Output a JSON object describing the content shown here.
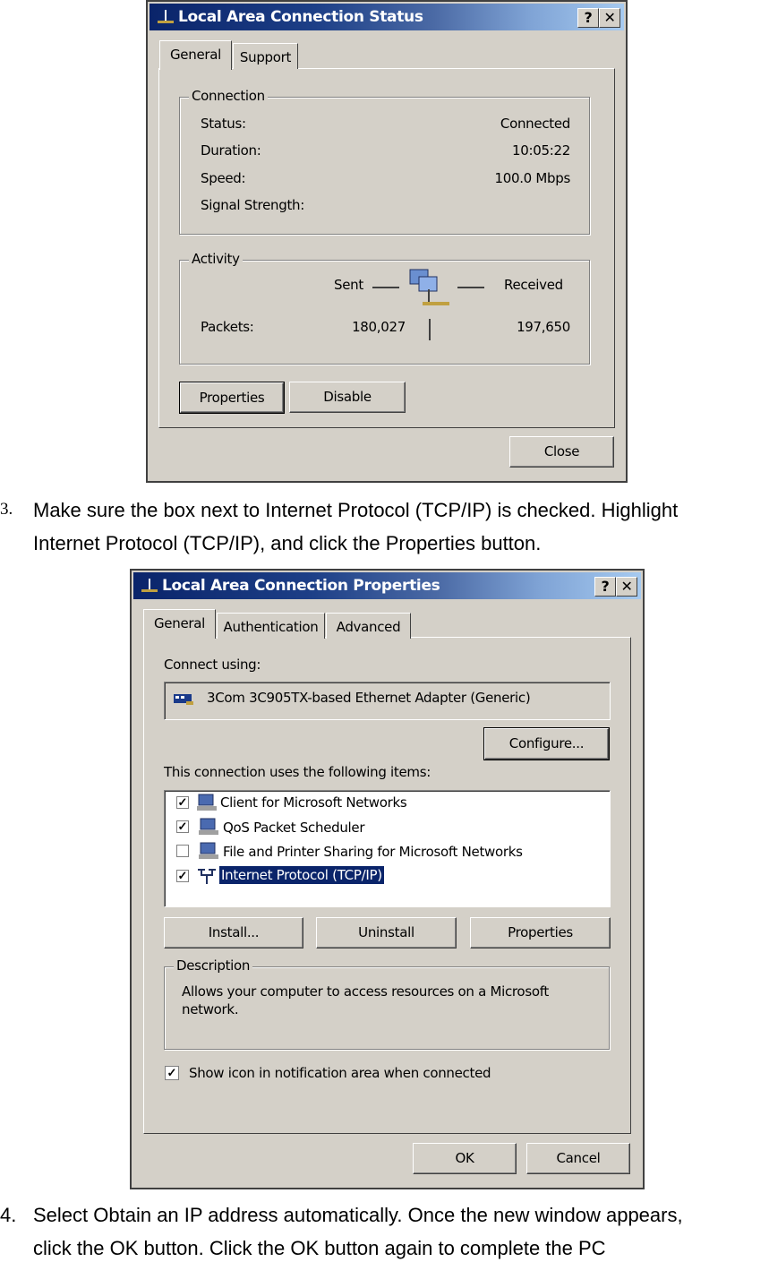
{
  "status_dialog": {
    "title": "Local Area Connection Status",
    "help_label": "?",
    "close_x": "✕",
    "tabs": [
      "General",
      "Support"
    ],
    "connection": {
      "label": "Connection",
      "rows": [
        {
          "label": "Status:",
          "value": "Connected"
        },
        {
          "label": "Duration:",
          "value": "10:05:22"
        },
        {
          "label": "Speed:",
          "value": "100.0 Mbps"
        },
        {
          "label": "Signal Strength:",
          "value": ""
        }
      ]
    },
    "activity": {
      "label": "Activity",
      "sent": "Sent",
      "received": "Received",
      "packets_label": "Packets:",
      "packets_sent": "180,027",
      "packets_received": "197,650",
      "icon": "network-computers-icon"
    },
    "buttons": {
      "properties": "Properties",
      "disable": "Disable",
      "close": "Close"
    }
  },
  "step3": {
    "number": "3.",
    "line1": "Make sure the box next to Internet Protocol (TCP/IP) is checked. Highlight",
    "line2": "Internet Protocol (TCP/IP), and click the Properties button."
  },
  "properties_dialog": {
    "title": "Local Area Connection Properties",
    "help_label": "?",
    "close_x": "✕",
    "tabs": [
      "General",
      "Authentication",
      "Advanced"
    ],
    "connect_using_label": "Connect using:",
    "adapter": "3Com 3C905TX-based Ethernet Adapter (Generic)",
    "configure": "Configure...",
    "items_label": "This connection uses the following items:",
    "items": [
      {
        "label": "Client for Microsoft Networks",
        "checked": true
      },
      {
        "label": "QoS Packet Scheduler",
        "checked": true
      },
      {
        "label": "File and Printer Sharing for Microsoft Networks",
        "checked": false
      },
      {
        "label": "Internet Protocol (TCP/IP)",
        "checked": true,
        "selected": true
      }
    ],
    "buttons": {
      "install": "Install...",
      "uninstall": "Uninstall",
      "properties": "Properties",
      "ok": "OK",
      "cancel": "Cancel"
    },
    "description": {
      "label": "Description",
      "line1": "Allows your computer to access resources on a Microsoft",
      "line2": "network."
    },
    "show_icon": {
      "label": "Show icon in notification area when connected",
      "checked": true
    },
    "selection_color": "#0a246a"
  },
  "step4": {
    "number": "4.",
    "line1": "Select Obtain an IP address automatically. Once the new window appears,",
    "line2": "click the OK button. Click the OK button again to complete the PC"
  }
}
